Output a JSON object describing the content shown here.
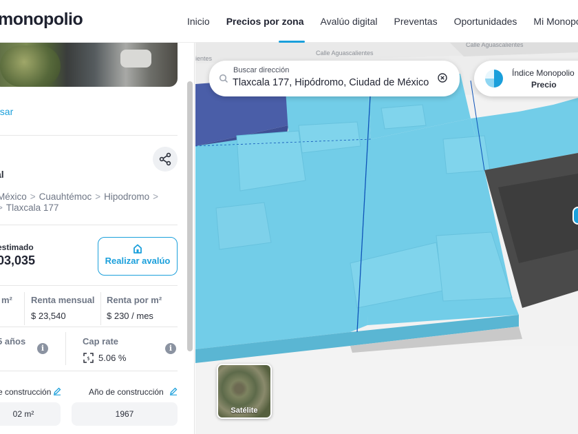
{
  "header": {
    "logo": "monopolio",
    "nav": [
      {
        "label": "Inicio",
        "active": false
      },
      {
        "label": "Precios por zona",
        "active": true
      },
      {
        "label": "Avalúo digital",
        "active": false
      },
      {
        "label": "Preventas",
        "active": false
      },
      {
        "label": "Oportunidades",
        "active": false
      },
      {
        "label": "Mi Monopolio",
        "active": false
      }
    ]
  },
  "panel": {
    "back_link": "esar",
    "property_type": "al",
    "breadcrumb": {
      "row1": [
        "México",
        "Cuauhtémoc",
        "Hipodromo"
      ],
      "row2": "Tlaxcala 177"
    },
    "price": {
      "label": "estimado",
      "value": "03,035"
    },
    "avaluo_button": "Realizar avalúo",
    "stats": {
      "col1_label": "m²",
      "renta_mensual_label": "Renta mensual",
      "renta_mensual_value": "$ 23,540",
      "renta_m2_label": "Renta por m²",
      "renta_m2_value": "$ 230 / mes",
      "years_label": "5 años",
      "cap_rate_label": "Cap rate",
      "cap_rate_value": "5.06 %"
    },
    "fields": {
      "construction_label": "e construcción",
      "construction_value": "02 m²",
      "year_label": "Año de construcción",
      "year_value": "1967"
    },
    "info_glyph": "i"
  },
  "map": {
    "search": {
      "label": "Buscar dirección",
      "value": "Tlaxcala 177, Hipódromo, Ciudad de México"
    },
    "index_chip": {
      "title": "Índice Monopolio",
      "subtitle": "Precio"
    },
    "streets": [
      "Calle Aguascalientes",
      "Calle Aguascalientes",
      "ientes"
    ],
    "satellite_label": "Satélite",
    "colors": {
      "accent": "#1a9fdb",
      "lot_fill": "#72cde8",
      "dark_lot": "#4a4a4a",
      "navy_lot": "#4a5ea8"
    }
  }
}
